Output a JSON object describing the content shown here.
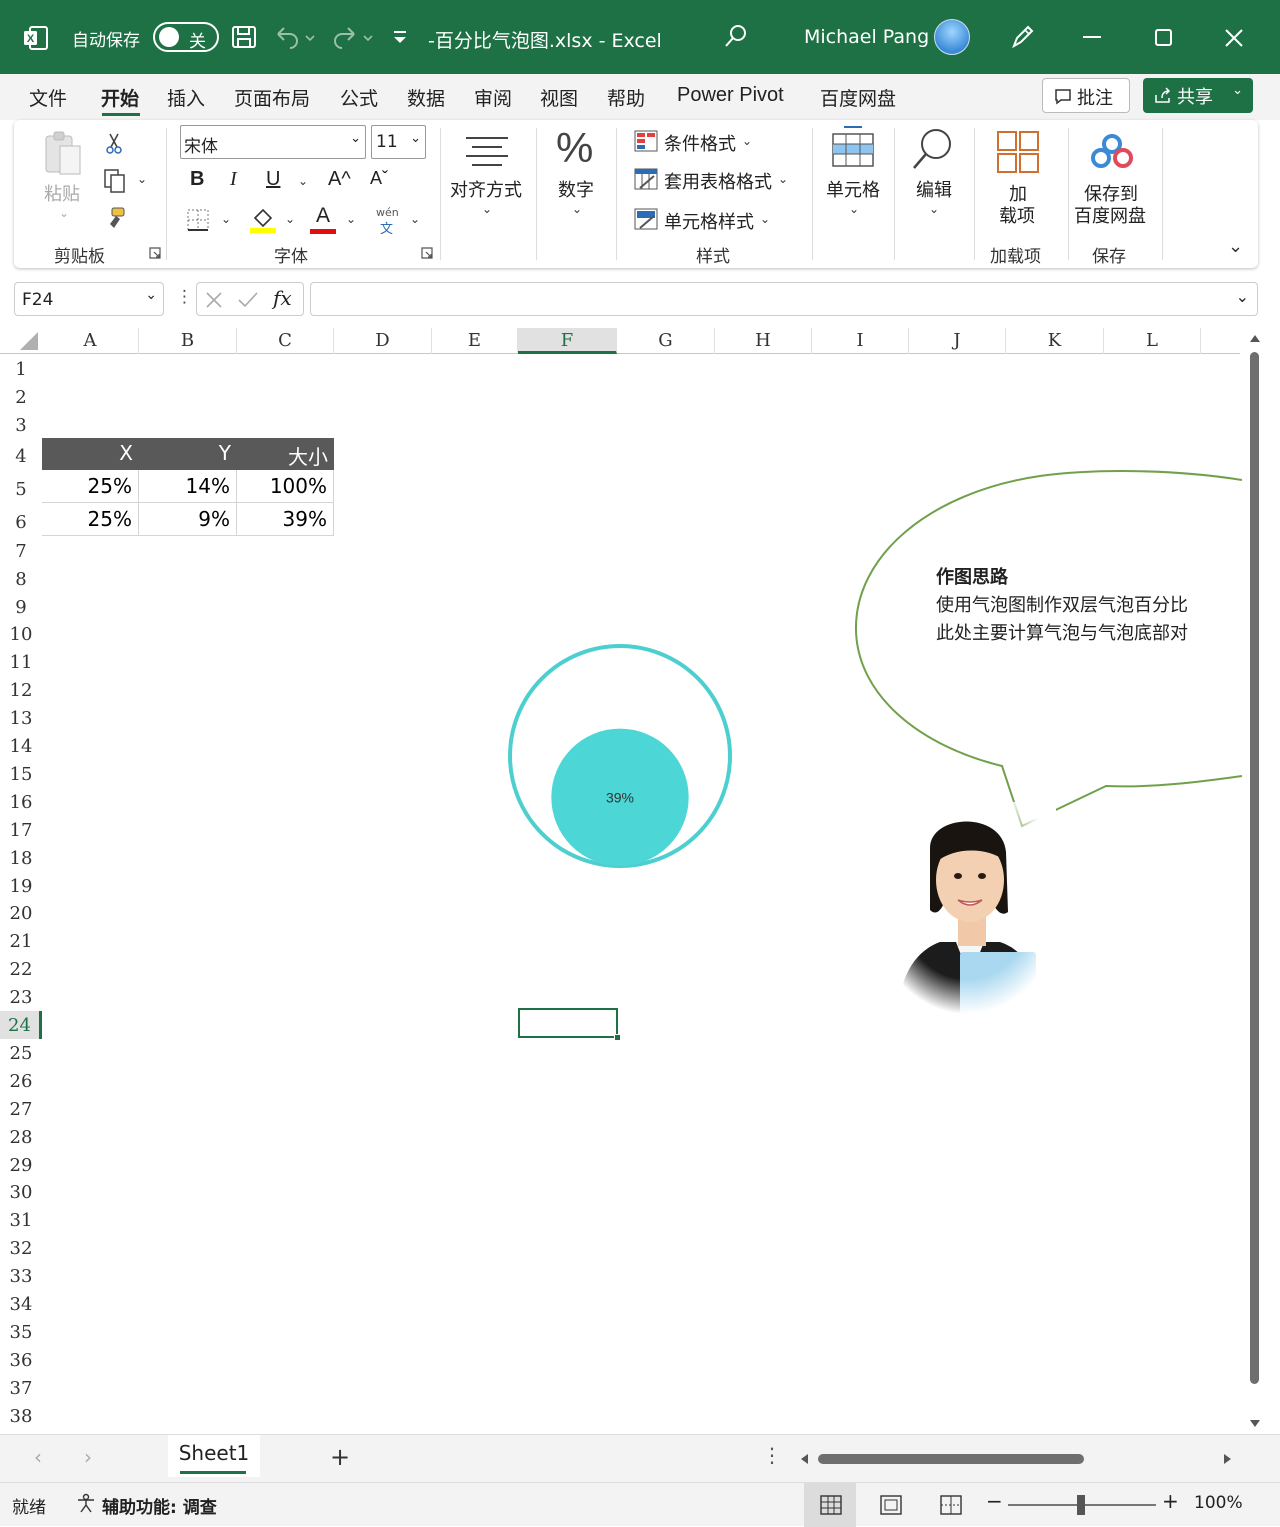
{
  "titlebar": {
    "autosave_label": "自动保存",
    "toggle_state": "关",
    "filename": "-百分比气泡图.xlsx  -  Excel",
    "username": "Michael Pang"
  },
  "menu": {
    "tabs": [
      "文件",
      "开始",
      "插入",
      "页面布局",
      "公式",
      "数据",
      "审阅",
      "视图",
      "帮助",
      "Power Pivot",
      "百度网盘"
    ],
    "active": "开始",
    "comment_label": "批注",
    "share_label": "共享"
  },
  "ribbon": {
    "paste_label": "粘贴",
    "clipboard_label": "剪贴板",
    "font_name": "宋体",
    "font_size": "11",
    "bold": "B",
    "italic": "I",
    "underline": "U",
    "grow_font": "A^",
    "shrink_font": "Aˇ",
    "font_color_glyph": "A",
    "phonetic_top": "wén",
    "phonetic_bottom": "文",
    "font_label": "字体",
    "align_label": "对齐方式",
    "number_label": "数字",
    "percent_glyph": "%",
    "cond_format": "条件格式",
    "table_format": "套用表格格式",
    "cell_style": "单元格样式",
    "styles_label": "样式",
    "cells_label": "单元格",
    "edit_label": "编辑",
    "addin_line1": "加",
    "addin_line2": "载项",
    "addins_label": "加载项",
    "save_baidu_line1": "保存到",
    "save_baidu_line2": "百度网盘",
    "save_label": "保存"
  },
  "formula_bar": {
    "name_box": "F24",
    "fx": "fx",
    "formula": ""
  },
  "grid": {
    "columns": [
      "A",
      "B",
      "C",
      "D",
      "E",
      "F",
      "G",
      "H",
      "I",
      "J",
      "K",
      "L"
    ],
    "selected_column": "F",
    "rows": [
      "1",
      "2",
      "3",
      "4",
      "5",
      "6",
      "7",
      "8",
      "9",
      "10",
      "11",
      "12",
      "13",
      "14",
      "15",
      "16",
      "17",
      "18",
      "19",
      "20",
      "21",
      "22",
      "23",
      "24",
      "25",
      "26",
      "27",
      "28",
      "29",
      "30",
      "31",
      "32",
      "33",
      "34",
      "35",
      "36",
      "37",
      "38"
    ],
    "selected_row": "24",
    "table": {
      "headers": [
        "X",
        "Y",
        "大小"
      ],
      "rows": [
        [
          "25%",
          "14%",
          "100%"
        ],
        [
          "25%",
          "9%",
          "39%"
        ]
      ]
    }
  },
  "chart_data": {
    "type": "scatter",
    "subtype": "bubble",
    "title": "",
    "series": [
      {
        "name": "",
        "x": [
          0.25
        ],
        "y": [
          0.14
        ],
        "size": [
          1.0
        ],
        "style": "outline",
        "color": "#4ecfcf"
      },
      {
        "name": "",
        "x": [
          0.25
        ],
        "y": [
          0.09
        ],
        "size": [
          0.39
        ],
        "style": "filled",
        "color": "#4dd6d6",
        "label": "39%"
      }
    ],
    "legend": "none",
    "grid": false,
    "axes_visible": false
  },
  "callout": {
    "title": "作图思路",
    "line1": "使用气泡图制作双层气泡百分比",
    "line2": "此处主要计算气泡与气泡底部对",
    "border_color": "#70a04a"
  },
  "sheets": {
    "tabs": [
      "Sheet1"
    ],
    "active": "Sheet1",
    "add": "+"
  },
  "status": {
    "ready": "就绪",
    "accessibility": "辅助功能: 调查",
    "zoom": "100%"
  },
  "colors": {
    "excel_green": "#1e7145",
    "header_fill": "#595959",
    "bubble": "#4dd6d6"
  }
}
